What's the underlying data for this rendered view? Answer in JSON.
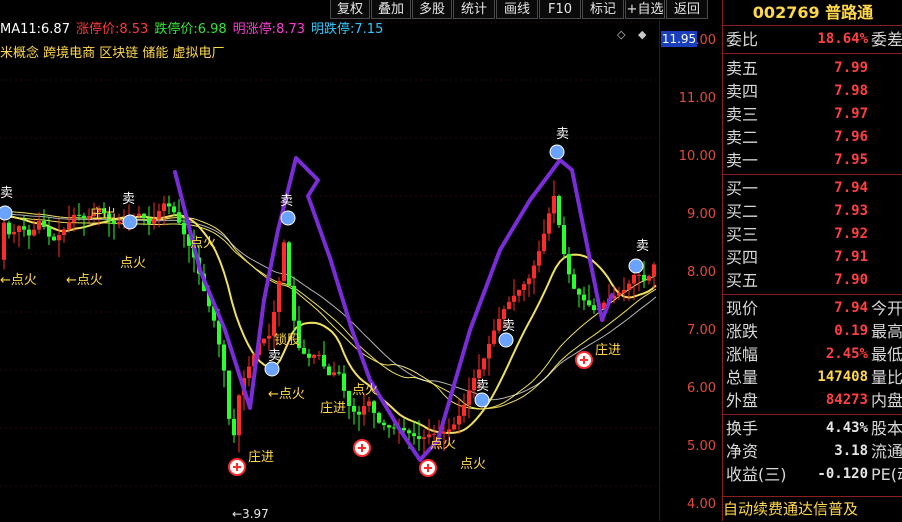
{
  "toolbar": {
    "buttons": [
      "复权",
      "叠加",
      "多股",
      "统计",
      "画线",
      "F10",
      "标记",
      "+自选",
      "返回"
    ]
  },
  "indicators": [
    {
      "label": "MA11:",
      "value": "6.87",
      "color": "#ffffff"
    },
    {
      "label": "涨停价:",
      "value": "8.53",
      "color": "#ff3b3b"
    },
    {
      "label": "跌停价:",
      "value": "6.98",
      "color": "#33e633"
    },
    {
      "label": "明涨停:",
      "value": "8.73",
      "color": "#ff3bd8"
    },
    {
      "label": "明跌停:",
      "value": "7.15",
      "color": "#33c8ff"
    }
  ],
  "concepts": "米概念 跨境电商 区块链 储能 虚拟电厂",
  "chart_data": {
    "type": "candlestick",
    "y_axis_ticks": [
      "12.00",
      "11.00",
      "10.00",
      "9.00",
      "8.00",
      "7.00",
      "6.00",
      "5.00",
      "4.00"
    ],
    "current_price_label": "11.95",
    "low_label": "←3.97",
    "annotations": {
      "sell": "卖",
      "fire": "点火",
      "fire_arrow": "←点火",
      "zhuang_in": "庄进",
      "zhuang_out": "庄出",
      "lock": "锁股"
    },
    "colors": {
      "up": "#ff2a2a",
      "down": "#2bff2b",
      "ma_yellow": "#f0e060",
      "ma_white": "#ffffff",
      "pen": "#7a2cd8"
    }
  },
  "stock": {
    "code": "002769",
    "name": "普路通"
  },
  "weibi": {
    "label": "委比",
    "value": "18.64%",
    "extra": "委差"
  },
  "sell_orders": [
    {
      "label": "卖五",
      "price": "7.99"
    },
    {
      "label": "卖四",
      "price": "7.98"
    },
    {
      "label": "卖三",
      "price": "7.97"
    },
    {
      "label": "卖二",
      "price": "7.96"
    },
    {
      "label": "卖一",
      "price": "7.95"
    }
  ],
  "buy_orders": [
    {
      "label": "买一",
      "price": "7.94"
    },
    {
      "label": "买二",
      "price": "7.93"
    },
    {
      "label": "买三",
      "price": "7.92"
    },
    {
      "label": "买四",
      "price": "7.91"
    },
    {
      "label": "买五",
      "price": "7.90"
    }
  ],
  "quote": [
    {
      "label": "现价",
      "value": "7.94",
      "extra": "今开",
      "color": "#ff4040"
    },
    {
      "label": "涨跌",
      "value": "0.19",
      "extra": "最高",
      "color": "#ff4040"
    },
    {
      "label": "涨幅",
      "value": "2.45%",
      "extra": "最低",
      "color": "#ff4040"
    },
    {
      "label": "总量",
      "value": "147408",
      "extra": "量比",
      "color": "#ffd84a"
    },
    {
      "label": "外盘",
      "value": "84273",
      "extra": "内盘",
      "color": "#ff4040"
    }
  ],
  "finance": [
    {
      "label": "换手",
      "value": "4.43%",
      "extra": "股本"
    },
    {
      "label": "净资",
      "value": "3.18",
      "extra": "流通"
    },
    {
      "label": "收益(三)",
      "value": "-0.120",
      "extra": "PE(动)"
    }
  ],
  "ad": "自动续费通达信普及"
}
